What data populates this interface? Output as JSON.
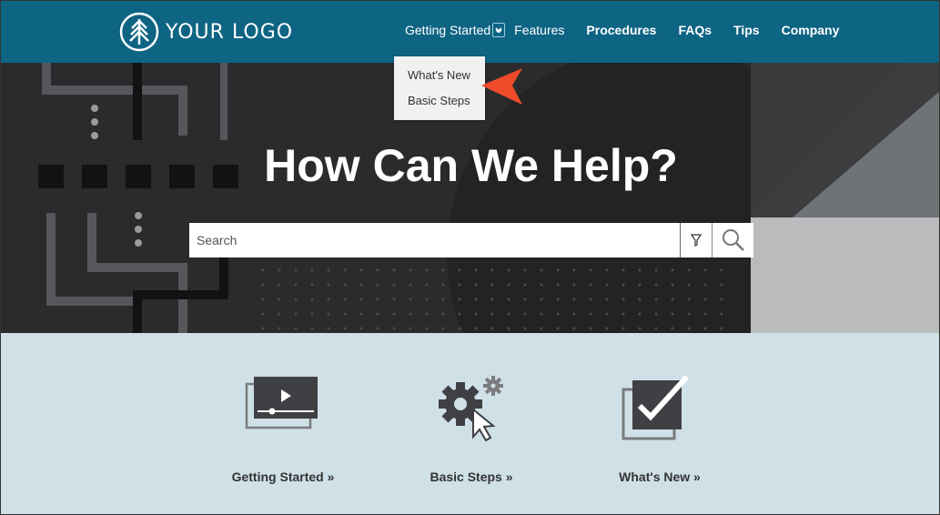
{
  "header": {
    "logo_text": "YOUR LOGO",
    "nav": [
      {
        "label": "Getting Started"
      },
      {
        "label": "Features"
      },
      {
        "label": "Procedures"
      },
      {
        "label": "FAQs"
      },
      {
        "label": "Tips"
      },
      {
        "label": "Company"
      }
    ]
  },
  "dropdown": {
    "items": [
      {
        "label": "What's New"
      },
      {
        "label": "Basic Steps"
      }
    ]
  },
  "hero": {
    "title": "How Can We Help?",
    "search": {
      "placeholder": "Search",
      "value": ""
    }
  },
  "tiles": [
    {
      "label": "Getting Started »",
      "icon": "video-player-icon"
    },
    {
      "label": "Basic Steps »",
      "icon": "gear-cursor-icon"
    },
    {
      "label": "What's New »",
      "icon": "checkbox-check-icon"
    }
  ],
  "colors": {
    "header_bg": "#0e6483",
    "hero_bg": "#2b2b2d",
    "tiles_bg": "#cfe0e7",
    "callout": "#ee4b2b"
  }
}
